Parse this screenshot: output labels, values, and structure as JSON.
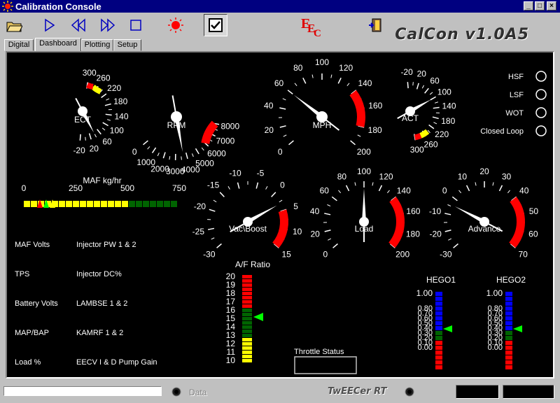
{
  "window": {
    "title": "Calibration Console"
  },
  "toolbar": {
    "brand": "CalCon v1.0A5",
    "buttons": [
      {
        "name": "open-folder-button",
        "icon": "folder-icon"
      },
      {
        "name": "play-button",
        "icon": "play-icon"
      },
      {
        "name": "rewind-button",
        "icon": "rewind-icon"
      },
      {
        "name": "fast-forward-button",
        "icon": "fast-forward-icon"
      },
      {
        "name": "stop-button",
        "icon": "stop-icon"
      },
      {
        "name": "record-button",
        "icon": "record-icon"
      },
      {
        "name": "checkbox-toggle-button",
        "icon": "check-icon"
      },
      {
        "name": "eec-button",
        "icon": "eec-logo-icon",
        "label": "EEC"
      },
      {
        "name": "exit-button",
        "icon": "exit-door-icon"
      }
    ]
  },
  "tabs": [
    {
      "label": "Digital",
      "active": false
    },
    {
      "label": "Dashboard",
      "active": true
    },
    {
      "label": "Plotting",
      "active": false
    },
    {
      "label": "Setup",
      "active": false
    }
  ],
  "gauges": [
    {
      "id": "ect",
      "label": "ECT",
      "ticks": [
        "-20",
        "20",
        "60",
        "100",
        "140",
        "180",
        "220",
        "260",
        "300"
      ]
    },
    {
      "id": "rpm",
      "label": "RPM",
      "ticks": [
        "0",
        "1000",
        "2000",
        "3000",
        "4000",
        "5000",
        "6000",
        "7000",
        "8000"
      ]
    },
    {
      "id": "mph",
      "label": "MPH",
      "ticks": [
        "0",
        "20",
        "40",
        "60",
        "80",
        "100",
        "120",
        "140",
        "160",
        "180",
        "200"
      ]
    },
    {
      "id": "act",
      "label": "ACT",
      "ticks": [
        "-20",
        "20",
        "60",
        "100",
        "140",
        "180",
        "220",
        "260",
        "300"
      ]
    },
    {
      "id": "boost",
      "label": "Vac\\Boost",
      "ticks": [
        "-30",
        "-25",
        "-20",
        "-15",
        "-10",
        "-5",
        "0",
        "5",
        "10",
        "15"
      ]
    },
    {
      "id": "load",
      "label": "Load",
      "ticks": [
        "0",
        "20",
        "40",
        "60",
        "80",
        "100",
        "120",
        "140",
        "160",
        "180",
        "200"
      ]
    },
    {
      "id": "advance",
      "label": "Advance",
      "ticks": [
        "-30",
        "-20",
        "-10",
        "0",
        "10",
        "20",
        "30",
        "40",
        "50",
        "60",
        "70"
      ]
    }
  ],
  "indicators": [
    {
      "label": "HSF"
    },
    {
      "label": "LSF"
    },
    {
      "label": "WOT"
    },
    {
      "label": "Closed Loop"
    }
  ],
  "maf": {
    "title": "MAF kg/hr",
    "ticks": [
      "0",
      "250",
      "500",
      "750"
    ]
  },
  "readouts": [
    {
      "label": "MAF Volts"
    },
    {
      "label": "Injector PW 1 & 2"
    },
    {
      "label": "TPS"
    },
    {
      "label": "Injector DC%"
    },
    {
      "label": "Battery Volts"
    },
    {
      "label": "LAMBSE 1 & 2"
    },
    {
      "label": "MAP/BAP"
    },
    {
      "label": "KAMRF 1 & 2"
    },
    {
      "label": "Load %"
    },
    {
      "label": "EECV I & D Pump Gain"
    }
  ],
  "afr": {
    "title": "A/F Ratio",
    "ticks": [
      "20",
      "19",
      "18",
      "17",
      "16",
      "15",
      "14",
      "13",
      "12",
      "11",
      "10"
    ]
  },
  "throttle": {
    "label": "Throttle Status"
  },
  "hego": [
    {
      "title": "HEGO1",
      "ticks": [
        "1.00",
        "0.80",
        "0.70",
        "0.60",
        "0.50",
        "0.40",
        "0.30",
        "0.20",
        "0.10",
        "0.00"
      ]
    },
    {
      "title": "HEGO2",
      "ticks": [
        "1.00",
        "0.80",
        "0.70",
        "0.60",
        "0.50",
        "0.40",
        "0.30",
        "0.20",
        "0.10",
        "0.00"
      ]
    }
  ],
  "status": {
    "data_label": "Data",
    "logo": "TwEECer RT"
  },
  "colors": {
    "red": "#ff0000",
    "yellow": "#ffff00",
    "green": "#006400",
    "blue": "#0000ff",
    "pointer_green": "#00ff00"
  }
}
